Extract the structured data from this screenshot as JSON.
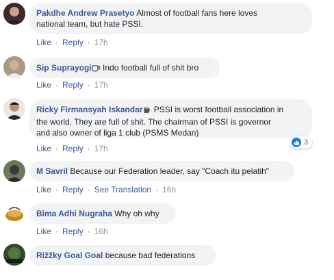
{
  "actions": {
    "like": "Like",
    "reply": "Reply",
    "see_translation": "See Translation"
  },
  "comments": [
    {
      "name": "Pakdhe Andrew Prasetyo",
      "text_line1": "Almost of football fans here loves",
      "text_line2": "national team, but hate PSSI.",
      "time": "17h",
      "avatar_color": "#6b4a4a"
    },
    {
      "name": "Sip Suprayogi",
      "text_line1": "Indo football full of shit bro",
      "time": "17h",
      "icon": "coffee-icon",
      "avatar_color": "#7d6a52"
    },
    {
      "name": "Ricky Firmansyah Iskandar",
      "text_line1": "PSSI is worst football association in",
      "text_line2": "the world. They are full of shit. The chairman of PSSI is governor",
      "text_line3": "and also owner of liga 1 club (PSMS Medan)",
      "time": "17h",
      "icon": "waving-hand-icon",
      "reaction_count": "3",
      "avatar_color": "#4a3b3b"
    },
    {
      "name": "M Savril",
      "text_line1": "Because our Federation leader, say \"Coach itu pelatih\"",
      "time": "16h",
      "avatar_color": "#3f4a3a"
    },
    {
      "name": "Bima Adhi Nugraha",
      "text_line1": "Why oh why",
      "time": "16h",
      "avatar_color": "#b8892d"
    },
    {
      "name": "Rižžky Goal Goal",
      "text_line1": "because bad federations",
      "avatar_color": "#3a5d3a"
    }
  ]
}
